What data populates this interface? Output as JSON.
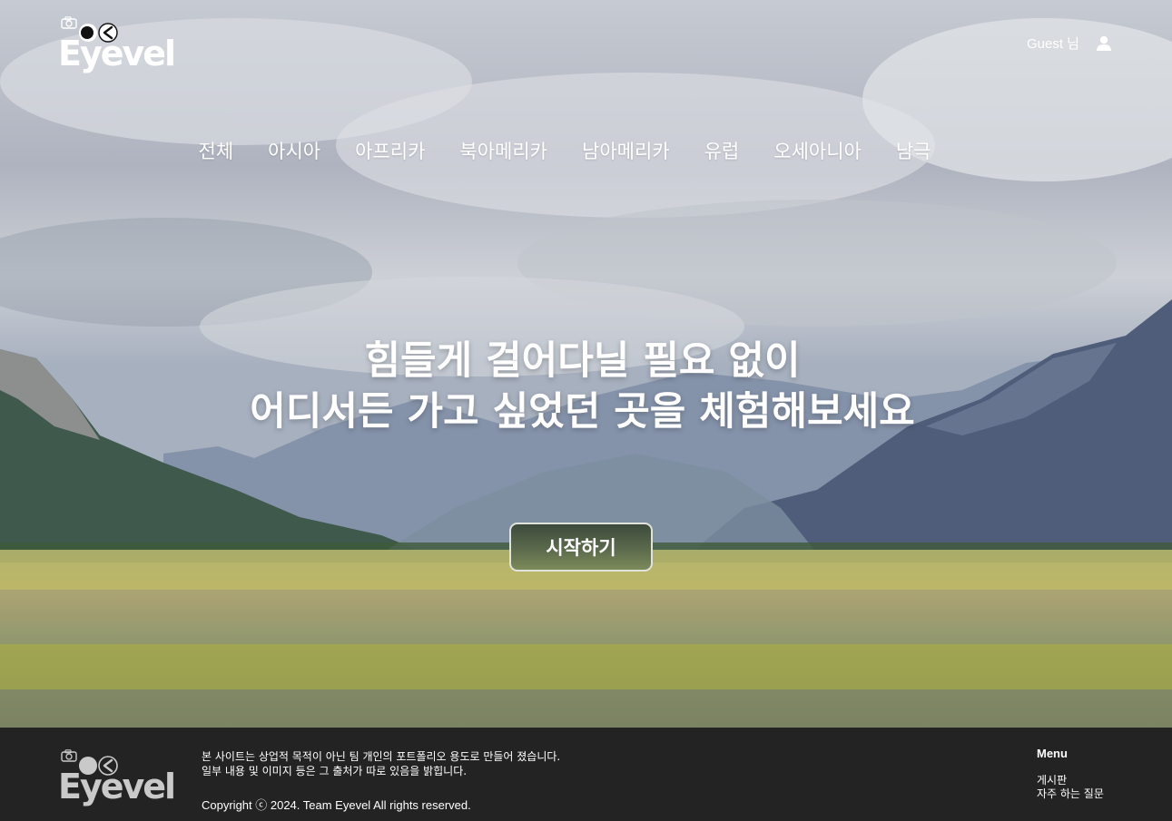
{
  "header": {
    "logo_text": "Eyevel",
    "user_name": "Guest 님",
    "nav": [
      "전체",
      "아시아",
      "아프리카",
      "북아메리카",
      "남아메리카",
      "유럽",
      "오세아니아",
      "남극"
    ]
  },
  "hero": {
    "headline_line1": "힘들게 걸어다닐 필요 없이",
    "headline_line2": "어디서든 가고 싶었던 곳을 체험해보세요",
    "start_button": "시작하기"
  },
  "footer": {
    "logo_text": "Eyevel",
    "notice_line1": "본 사이트는 상업적 목적이 아닌 팀 개인의 포트폴리오 용도로 만들어 졌습니다.",
    "notice_line2": "일부 내용 및 이미지 등은 그 출처가 따로 있음을 밝힙니다.",
    "copyright": "Copyright ⓒ 2024. Team Eyevel All rights reserved.",
    "menu_title": "Menu",
    "menu_links": [
      "게시판",
      "자주 하는 질문"
    ]
  },
  "icons": {
    "logo_camera": "camera-icon",
    "logo_eyes": "eyes-icon",
    "user": "user-icon"
  }
}
